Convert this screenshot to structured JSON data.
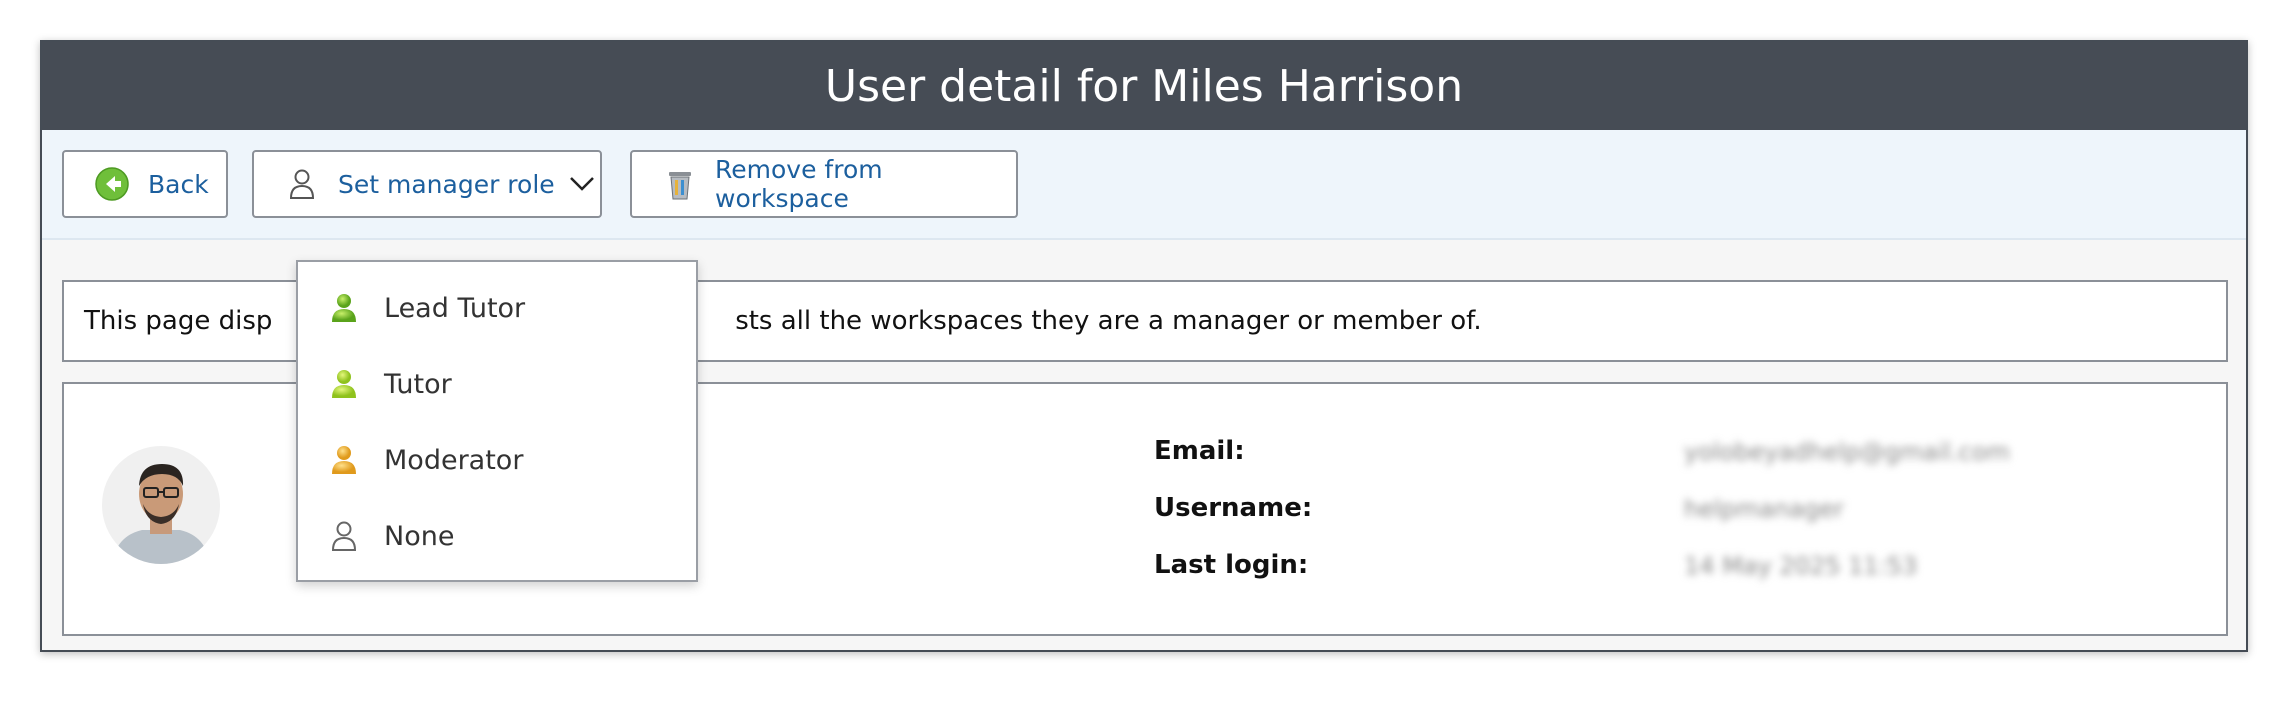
{
  "title": "User detail for Miles Harrison",
  "toolbar": {
    "back_label": "Back",
    "role_label": "Set manager role",
    "remove_label": "Remove from workspace"
  },
  "dropdown": {
    "items": [
      {
        "label": "Lead Tutor",
        "icon": "person-green-icon"
      },
      {
        "label": "Tutor",
        "icon": "person-green-icon"
      },
      {
        "label": "Moderator",
        "icon": "person-orange-icon"
      },
      {
        "label": "None",
        "icon": "person-outline-icon"
      }
    ]
  },
  "info": {
    "text": "This page disp                                                        sts all the workspaces they are a manager or member of."
  },
  "profile": {
    "email_label": "Email:",
    "email_value": "yolobeyadhelp@gmail.com",
    "username_label": "Username:",
    "username_value": "helpmanager",
    "lastlogin_label": "Last login:",
    "lastlogin_value": "14 May 2025 11:53"
  },
  "colors": {
    "titlebar": "#464c55",
    "link": "#1c5f9e",
    "toolbar_bg": "#eef5fb"
  }
}
